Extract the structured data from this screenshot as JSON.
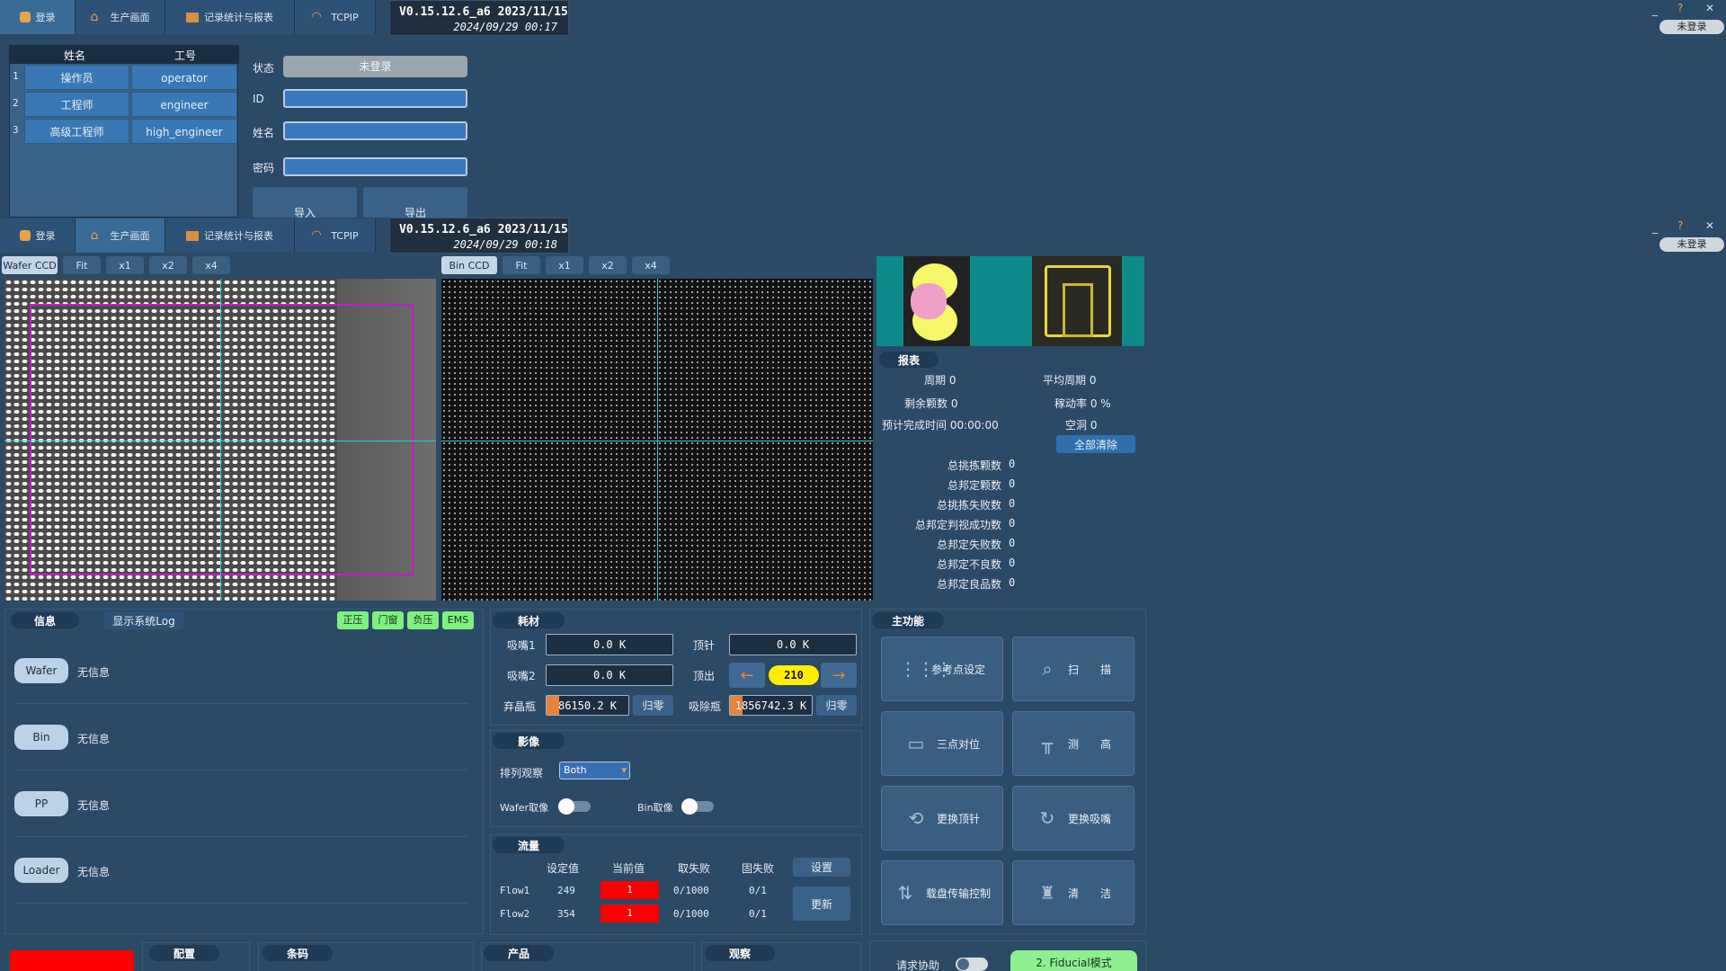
{
  "app": {
    "tabs": [
      "登录",
      "生产画面",
      "记录统计与报表",
      "TCPIP"
    ],
    "version": "V0.15.12.6_a6 2023/11/15",
    "time1": "2024/09/29 00:17",
    "time2": "2024/09/29 00:18",
    "login_status": "未登录"
  },
  "login": {
    "headers": [
      "姓名",
      "工号"
    ],
    "rows": [
      {
        "num": "1",
        "name": "操作员",
        "id": "operator"
      },
      {
        "num": "2",
        "name": "工程师",
        "id": "engineer"
      },
      {
        "num": "3",
        "name": "高级工程师",
        "id": "high_engineer"
      }
    ],
    "labels": {
      "status": "状态",
      "id": "ID",
      "name": "姓名",
      "password": "密码"
    },
    "status_value": "未登录",
    "import_label": "导入",
    "export_label": "导出"
  },
  "camera": {
    "wafer_tabs": [
      "Wafer CCD",
      "Fit",
      "x1",
      "x2",
      "x4"
    ],
    "bin_tabs": [
      "Bin CCD",
      "Fit",
      "x1",
      "x2",
      "x4"
    ]
  },
  "report": {
    "title": "报表",
    "cycle": "周期 0",
    "avg_cycle": "平均周期 0",
    "remaining": "剩余颗数 0",
    "util": "稼动率 0 %",
    "eta": "预计完成时间 00:00:00",
    "idle": "空洞 0",
    "clear_all": "全部清除",
    "totals": [
      {
        "label": "总挑拣颗数",
        "value": "0"
      },
      {
        "label": "总邦定颗数",
        "value": "0"
      },
      {
        "label": "总挑拣失败数",
        "value": "0"
      },
      {
        "label": "总邦定判视成功数",
        "value": "0"
      },
      {
        "label": "总邦定失败数",
        "value": "0"
      },
      {
        "label": "总邦定不良数",
        "value": "0"
      },
      {
        "label": "总邦定良品数",
        "value": "0"
      }
    ]
  },
  "info": {
    "title": "信息",
    "show_log": "显示系统Log",
    "status_badges": [
      "正压",
      "门窗",
      "负压",
      "EMS"
    ],
    "items": [
      {
        "label": "Wafer",
        "value": "无信息"
      },
      {
        "label": "Bin",
        "value": "无信息"
      },
      {
        "label": "PP",
        "value": "无信息"
      },
      {
        "label": "Loader",
        "value": "无信息"
      }
    ]
  },
  "consumables": {
    "title": "耗材",
    "nozzle1_label": "吸嘴1",
    "nozzle1_value": "0.0 K",
    "nozzle2_label": "吸嘴2",
    "nozzle2_value": "0.0 K",
    "needle_label": "顶针",
    "needle_value": "0.0 K",
    "eject_label": "顶出",
    "eject_value": "210",
    "reject_label": "弃晶瓶",
    "reject_value": "86150.2 K",
    "suction_label": "吸除瓶",
    "suction_value": "1856742.3 K",
    "reset_label": "归零",
    "reject_fill": 0.15,
    "suction_fill": 0.15
  },
  "imaging": {
    "title": "影像",
    "arrange_label": "排列观察",
    "arrange_value": "Both",
    "wafer_label": "Wafer取像",
    "bin_label": "Bin取像"
  },
  "flow": {
    "title": "流量",
    "headers": [
      "设定值",
      "当前值",
      "取失败",
      "固失败"
    ],
    "settings": "设置",
    "update": "更新",
    "rows": [
      {
        "name": "Flow1",
        "set": "249",
        "current": "1",
        "pick_fail": "0/1000",
        "fix_fail": "0/1"
      },
      {
        "name": "Flow2",
        "set": "354",
        "current": "1",
        "pick_fail": "0/1000",
        "fix_fail": "0/1"
      }
    ]
  },
  "main_functions": {
    "title": "主功能",
    "buttons": [
      {
        "label": "参考点设定",
        "icon": "grid-icon"
      },
      {
        "label": "扫　　描",
        "icon": "search-icon"
      },
      {
        "label": "三点对位",
        "icon": "frame-icon"
      },
      {
        "label": "测　　高",
        "icon": "height-icon"
      },
      {
        "label": "更换顶针",
        "icon": "swap-icon"
      },
      {
        "label": "更换吸嘴",
        "icon": "refresh-icon"
      },
      {
        "label": "载盘传输控制",
        "icon": "transfer-icon"
      },
      {
        "label": "清　　洁",
        "icon": "broom-icon"
      }
    ]
  },
  "bottom": {
    "config": "配置",
    "barcode": "条码",
    "product": "产品",
    "observe": "观察",
    "help": "请求协助",
    "mode": "2. Fiducial模式"
  },
  "colors": {
    "accent": "#3a6b96",
    "alarm": "#ff0000",
    "green_badge": "#7ff07f",
    "yellow": "#ffee00"
  }
}
